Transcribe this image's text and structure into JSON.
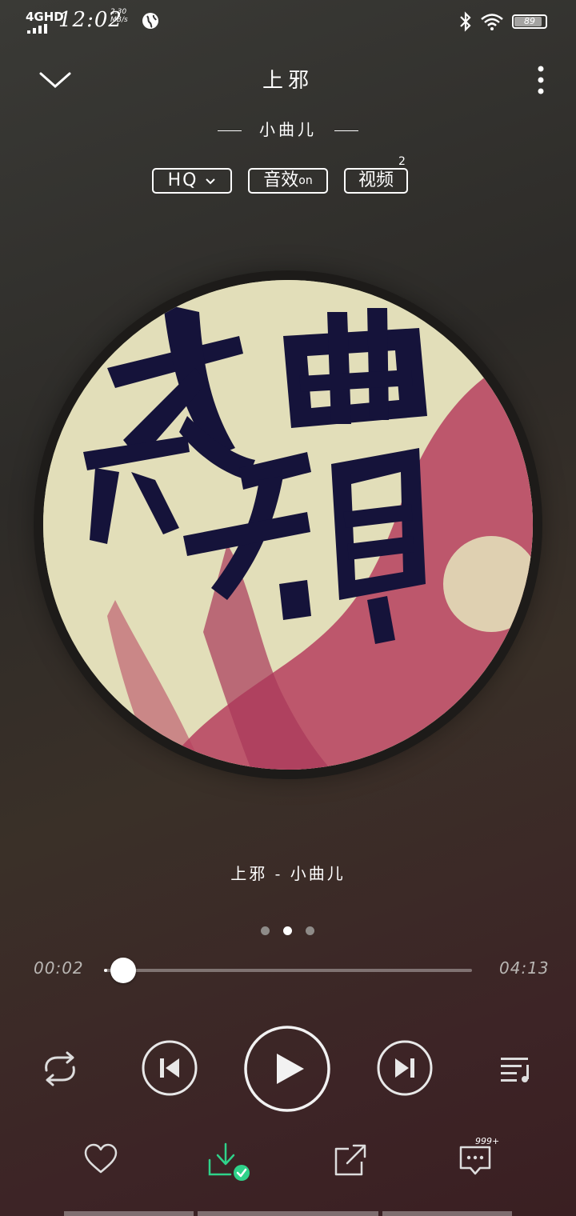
{
  "status_bar": {
    "network": "4GHD",
    "time": "12:02",
    "speed_value": "2.30",
    "speed_unit": "MB/s",
    "battery": "89"
  },
  "header": {
    "title": "上邪",
    "artist": "小曲儿"
  },
  "chips": {
    "quality": "HQ",
    "effect": "音效",
    "effect_state": "on",
    "video": "视频",
    "video_count": "2"
  },
  "lyric": "上邪 - 小曲儿",
  "pager": {
    "count": 3,
    "active": 1
  },
  "progress": {
    "current": "00:02",
    "total": "04:13",
    "fraction": 0.008
  },
  "comments_count": "999+",
  "colors": {
    "accent_green": "#2fd28a",
    "art_cream": "#e2deb9",
    "art_red": "#b6405e",
    "ink": "#15133a"
  }
}
